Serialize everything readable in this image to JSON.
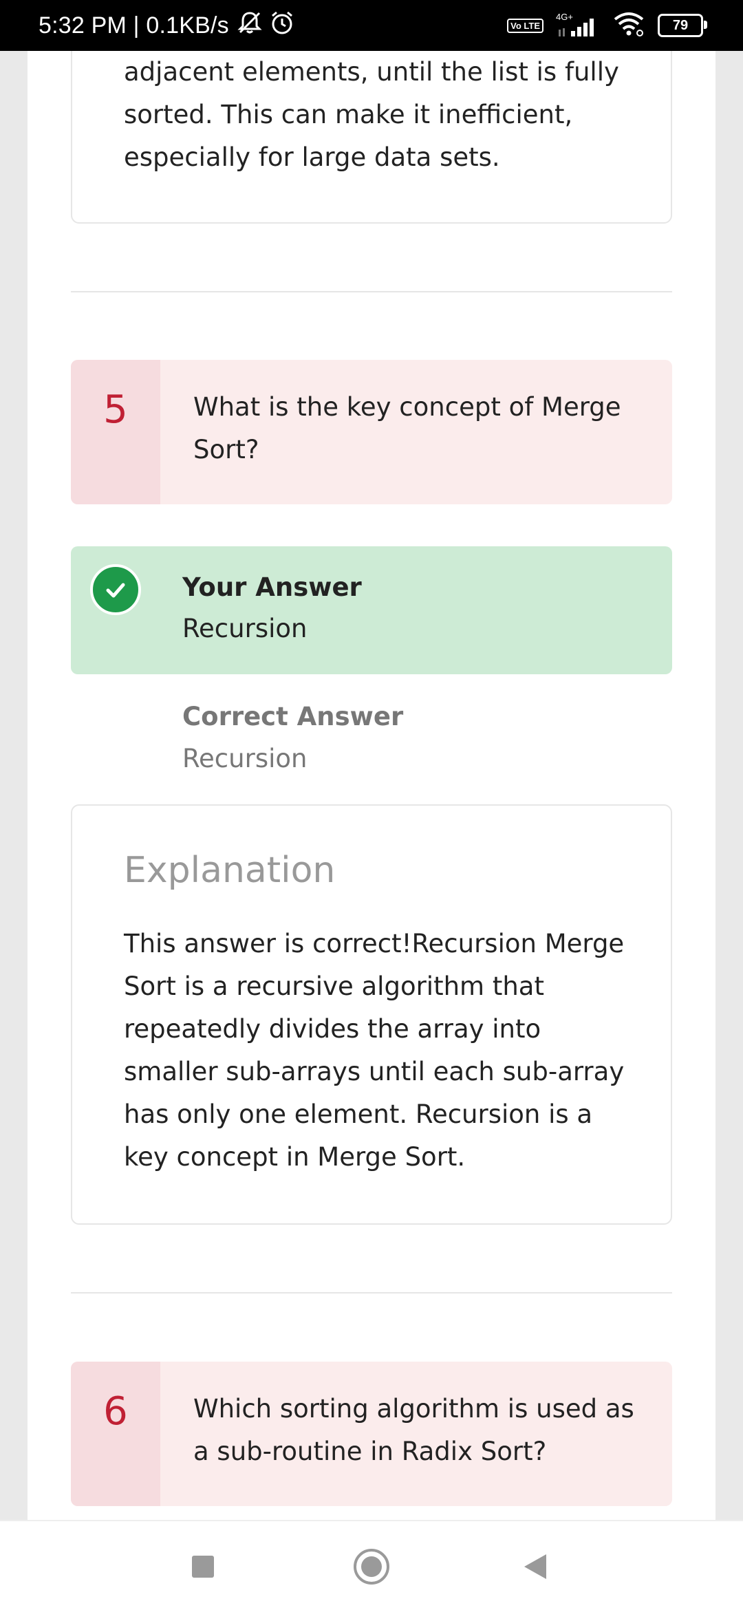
{
  "status_bar": {
    "time_speed": "5:32 PM | 0.1KB/s",
    "volte_label": "Vo LTE",
    "network_label": "4G+",
    "battery": "79",
    "icons": [
      "mute-icon",
      "alarm-icon",
      "signal-icon",
      "wifi-icon",
      "battery-icon"
    ]
  },
  "previous_explanation": {
    "lines": [
      "adjacent elements, until the list is fully",
      "sorted. This can make it inefficient,",
      "especially for large data sets."
    ]
  },
  "questions": [
    {
      "number": "5",
      "text": "What is the key concept of Merge Sort?",
      "your_answer_label": "Your Answer",
      "your_answer": "Recursion",
      "correct_answer_label": "Correct Answer",
      "correct_answer": "Recursion",
      "explanation_title": "Explanation",
      "explanation": "This answer is correct!Recursion Merge Sort is a recursive algorithm that repeatedly divides the array into smaller sub-arrays until each sub-array has only one element. Recursion is a key concept in Merge Sort."
    },
    {
      "number": "6",
      "text": "Which sorting algorithm is used as a sub-routine in Radix Sort?"
    }
  ],
  "colors": {
    "question_bg": "#fbecec",
    "question_number_bg": "#f6dcdf",
    "question_number_color": "#c02034",
    "answer_bg": "#cdebd5",
    "check_color": "#1e9a4a"
  },
  "nav_bar": {
    "icons": [
      "recents-square-icon",
      "home-circle-icon",
      "back-triangle-icon"
    ]
  }
}
